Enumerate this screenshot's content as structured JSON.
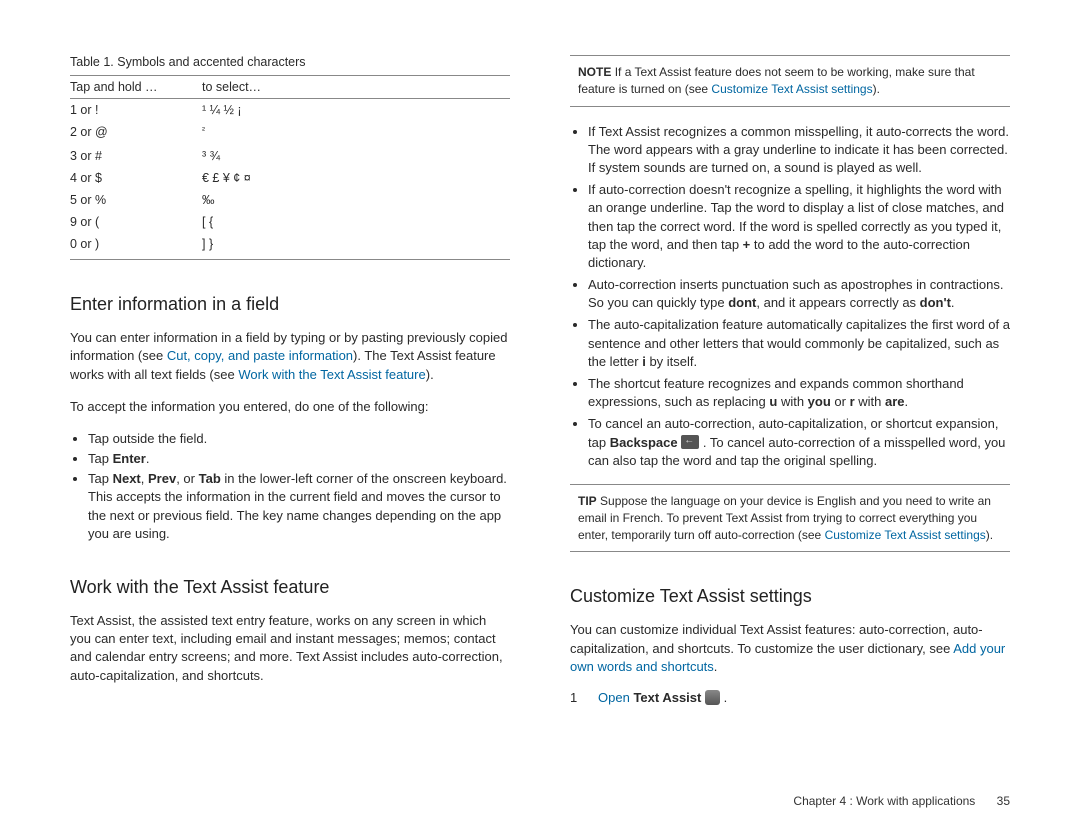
{
  "table": {
    "caption": "Table 1. Symbols and accented characters",
    "head": {
      "c1": "Tap and hold …",
      "c2": "to select…"
    },
    "rows": [
      {
        "k": "1 or !",
        "v": "¹ ¼ ½ ¡"
      },
      {
        "k": "2 or @",
        "v": "²"
      },
      {
        "k": "3 or #",
        "v": "³ ¾"
      },
      {
        "k": "4 or $",
        "v": "€ £ ¥ ¢ ¤"
      },
      {
        "k": "5 or %",
        "v": "‰"
      },
      {
        "k": "9 or (",
        "v": "[ {"
      },
      {
        "k": "0 or )",
        "v": "] }"
      }
    ]
  },
  "s1": {
    "title": "Enter information in a field",
    "p1a": "You can enter information in a field by typing or by pasting previously copied information (see ",
    "p1link": "Cut, copy, and paste information",
    "p1b": "). The Text Assist feature works with all text fields (see ",
    "p1link2": "Work with the Text Assist feature",
    "p1c": ").",
    "p2": "To accept the information you entered, do one of the following:",
    "b1": "Tap outside the field.",
    "b2a": "Tap ",
    "b2b": "Enter",
    "b2c": ".",
    "b3a": "Tap ",
    "b3b": "Next",
    "b3c": ", ",
    "b3d": "Prev",
    "b3e": ", or ",
    "b3f": "Tab",
    "b3g": " in the lower-left corner of the onscreen keyboard. This accepts the information in the current field and moves the cursor to the next or previous field. The key name changes depending on the app you are using."
  },
  "s2": {
    "title": "Work with the Text Assist feature",
    "p1": "Text Assist, the assisted text entry feature, works on any screen in which you can enter text, including email and instant messages; memos; contact and calendar entry screens; and more. Text Assist includes auto-correction, auto-capitalization, and shortcuts."
  },
  "note1": {
    "lead": "NOTE",
    "a": "If a Text Assist feature does not seem to be working, make sure that feature is turned on (see ",
    "link": "Customize Text Assist settings",
    "b": ")."
  },
  "bul": {
    "a": "If Text Assist recognizes a common misspelling, it auto-corrects the word. The word appears with a gray underline to indicate it has been corrected. If system sounds are turned on, a sound is played as well.",
    "b1": "If auto-correction doesn't recognize a spelling, it highlights the word with an orange underline. Tap the word to display a list of close matches, and then tap the correct word. If the word is spelled correctly as you typed it, tap the word, and then tap ",
    "b2": "+",
    "b3": " to add the word to the auto-correction dictionary.",
    "c1": "Auto-correction inserts punctuation such as apostrophes in contractions. So you can quickly type ",
    "c2": "dont",
    "c3": ", and it appears correctly as ",
    "c4": "don't",
    "c5": ".",
    "d1": "The auto-capitalization feature automatically capitalizes the first word of a sentence and other letters that would commonly be capitalized, such as the letter ",
    "d2": "i",
    "d3": " by itself.",
    "e1": "The shortcut feature recognizes and expands common shorthand expressions, such as replacing ",
    "e2": "u",
    "e3": " with ",
    "e4": "you",
    "e5": " or ",
    "e6": "r",
    "e7": " with ",
    "e8": "are",
    "e9": ".",
    "f1": "To cancel an auto-correction, auto-capitalization, or shortcut expansion, tap ",
    "f2": "Backspace",
    "f3": ". To cancel auto-correction of a misspelled word, you can also tap the word and tap the original spelling."
  },
  "tip": {
    "lead": "TIP",
    "a": "Suppose the language on your device is English and you need to write an email in French. To prevent Text Assist from trying to correct everything you enter, temporarily turn off auto-correction (see ",
    "link": "Customize Text Assist settings",
    "b": ")."
  },
  "s3": {
    "title": "Customize Text Assist settings",
    "p1": "You can customize individual Text Assist features: auto-correction, auto-capitalization, and shortcuts. To customize the user dictionary, see ",
    "link": "Add your own words and shortcuts",
    "p1b": ".",
    "step_num": "1",
    "step_link": "Open",
    "step_bold": "Text Assist",
    "step_tail": "."
  },
  "footer": {
    "chapter": "Chapter 4 : Work with applications",
    "page": "35"
  }
}
